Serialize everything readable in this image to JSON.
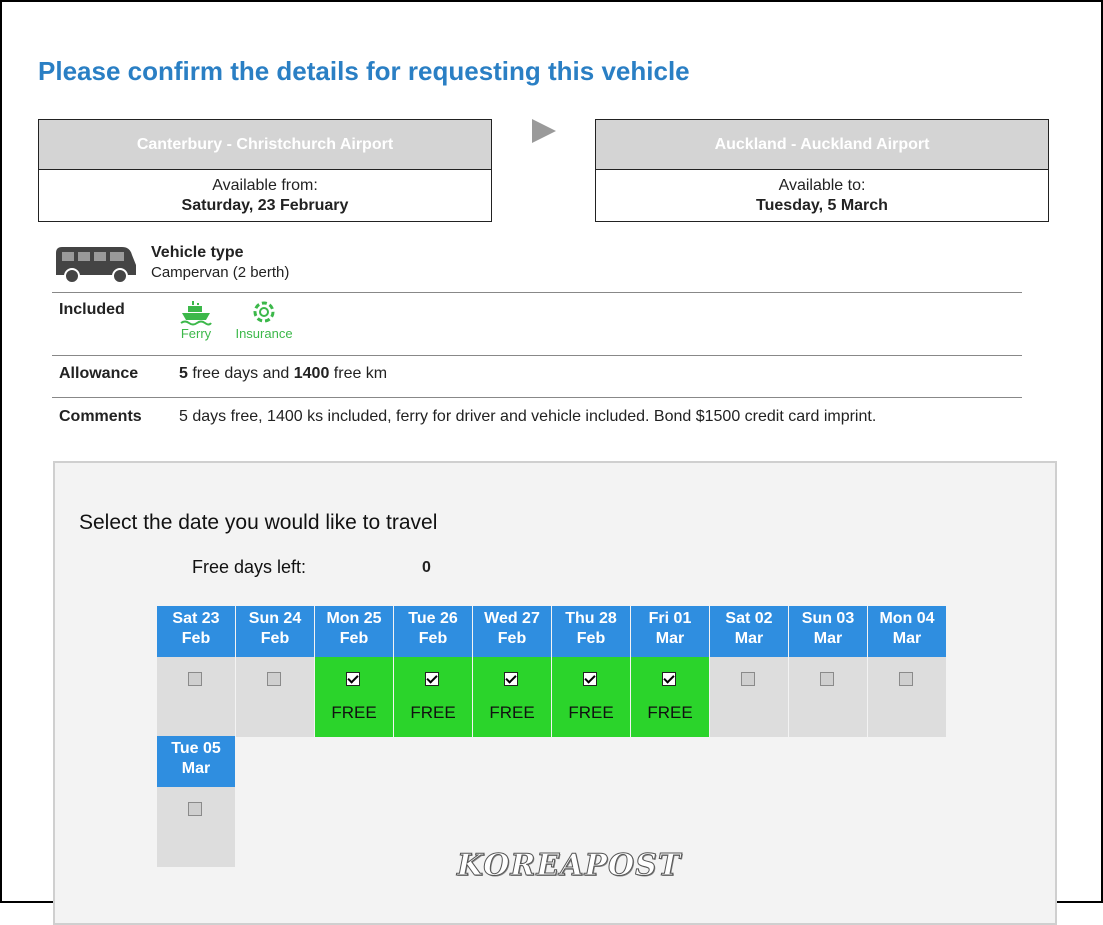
{
  "page": {
    "title": "Please confirm the details for requesting this vehicle"
  },
  "route": {
    "from": {
      "location": "Canterbury - Christchurch Airport",
      "label": "Available from:",
      "date": "Saturday, 23 February"
    },
    "to": {
      "location": "Auckland - Auckland Airport",
      "label": "Available to:",
      "date": "Tuesday, 5 March"
    }
  },
  "vehicle": {
    "label": "Vehicle type",
    "value": "Campervan (2 berth)"
  },
  "included": {
    "label": "Included",
    "items": [
      {
        "name": "Ferry",
        "icon": "ferry-icon"
      },
      {
        "name": "Insurance",
        "icon": "insurance-icon"
      }
    ]
  },
  "allowance": {
    "label": "Allowance",
    "days": "5",
    "days_text": " free days and ",
    "km": "1400",
    "km_text": " free km"
  },
  "comments": {
    "label": "Comments",
    "text": "5 days free, 1400 ks included, ferry for driver and vehicle included. Bond $1500 credit card imprint."
  },
  "calendar": {
    "title": "Select the date you would like to travel",
    "free_days_label": "Free days left:",
    "free_days_value": "0",
    "days": [
      {
        "day": "Sat 23",
        "month": "Feb",
        "checked": false,
        "status": ""
      },
      {
        "day": "Sun 24",
        "month": "Feb",
        "checked": false,
        "status": ""
      },
      {
        "day": "Mon 25",
        "month": "Feb",
        "checked": true,
        "status": "FREE"
      },
      {
        "day": "Tue 26",
        "month": "Feb",
        "checked": true,
        "status": "FREE"
      },
      {
        "day": "Wed 27",
        "month": "Feb",
        "checked": true,
        "status": "FREE"
      },
      {
        "day": "Thu 28",
        "month": "Feb",
        "checked": true,
        "status": "FREE"
      },
      {
        "day": "Fri 01",
        "month": "Mar",
        "checked": true,
        "status": "FREE"
      },
      {
        "day": "Sat 02",
        "month": "Mar",
        "checked": false,
        "status": ""
      },
      {
        "day": "Sun 03",
        "month": "Mar",
        "checked": false,
        "status": ""
      },
      {
        "day": "Mon 04",
        "month": "Mar",
        "checked": false,
        "status": ""
      },
      {
        "day": "Tue 05",
        "month": "Mar",
        "checked": false,
        "status": ""
      }
    ]
  },
  "watermark": "KOREAPOST",
  "colors": {
    "title": "#2a7fc4",
    "day_header": "#2f8ee0",
    "free": "#2bd42b",
    "included_icon": "#3cb84a"
  }
}
